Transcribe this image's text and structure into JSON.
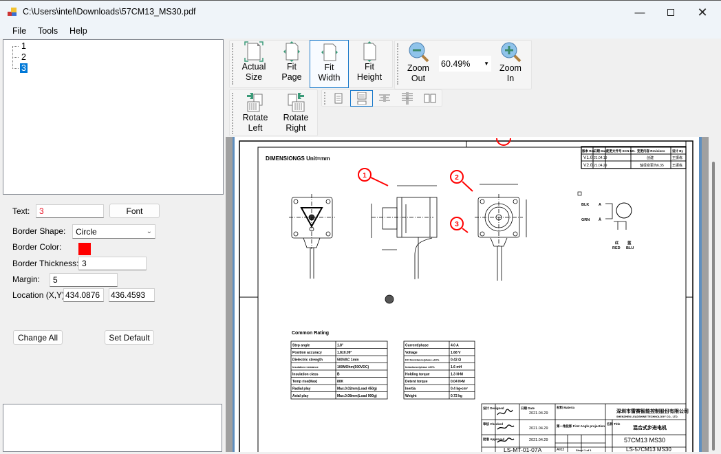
{
  "window": {
    "title": "C:\\Users\\intel\\Downloads\\57CM13_MS30.pdf",
    "minimize_icon": "minimize-icon",
    "maximize_icon": "maximize-icon",
    "close_icon": "close-icon"
  },
  "menu": [
    "File",
    "Tools",
    "Help"
  ],
  "tree": {
    "pages": [
      "1",
      "2",
      "3"
    ],
    "selected": "3"
  },
  "properties": {
    "text_label": "Text:",
    "text_value": "3",
    "text_color": "#ff0000",
    "font_button": "Font",
    "border_shape_label": "Border Shape:",
    "border_shape_value": "Circle",
    "border_color_label": "Border Color:",
    "border_color": "#ff0000",
    "border_thickness_label": "Border Thickness:",
    "border_thickness_value": "3",
    "margin_label": "Margin:",
    "margin_value": "5",
    "location_label": "Location (X,Y):",
    "location_x": "434.0876",
    "location_y": "436.4593",
    "change_all_button": "Change All",
    "set_default_button": "Set Default"
  },
  "toolbar": {
    "actual_size": [
      "Actual",
      "Size"
    ],
    "fit_page": [
      "Fit",
      "Page"
    ],
    "fit_width": [
      "Fit",
      "Width"
    ],
    "fit_height": [
      "Fit",
      "Height"
    ],
    "zoom_out": [
      "Zoom",
      "Out"
    ],
    "zoom_in": [
      "Zoom",
      "In"
    ],
    "zoom_value": "60.49%",
    "rotate_left": [
      "Rotate",
      "Left"
    ],
    "rotate_right": [
      "Rotate",
      "Right"
    ],
    "selected": "Fit Width",
    "selected_layout": "single-page-continuous"
  },
  "document": {
    "heading": "DIMENSIONGS Unit=mm",
    "annotations": [
      "1",
      "2",
      "3"
    ],
    "annotation_color": "#ff0000",
    "revision_table": {
      "headers": [
        "版本 Rev.",
        "日期 Date",
        "变更文件号 ECN NO.",
        "变更内容 Revisions",
        "设计 By"
      ],
      "rows": [
        [
          "V1.0",
          "21.04.19",
          "",
          "创建",
          "王振栋"
        ],
        [
          "V2.0",
          "21.04.29",
          "",
          "轴径变更为6.35",
          "王振栋"
        ]
      ]
    },
    "wiring": {
      "labels": [
        "BLK",
        "GRN",
        "RED",
        "BLU"
      ],
      "phases": [
        "A",
        "Ā"
      ],
      "colors_cn": [
        "红",
        "蓝"
      ]
    },
    "common_rating": {
      "title": "Common Rating",
      "left": [
        [
          "Step angle",
          "1.8°"
        ],
        [
          "Position accuracy",
          "1.8±0.09°"
        ],
        [
          "Dielectric strength",
          "500VAC 1min"
        ],
        [
          "Insulation resistance",
          "100MOhm(500VDC)"
        ],
        [
          "Insulation class",
          "B"
        ],
        [
          "Temp rise(Max)",
          "80K"
        ],
        [
          "Radial play",
          "Max.0.02mm(Load 450g)"
        ],
        [
          "Axial play",
          "Max.0.08mm(Load 900g)"
        ]
      ],
      "right": [
        [
          "Current/phase",
          "4.0 A"
        ],
        [
          "Voltage",
          "1.68 V"
        ],
        [
          "DC Resistance/phase ±10%",
          "0.42 Ω"
        ],
        [
          "Inductance/phase ±20%",
          "1.6 mH"
        ],
        [
          "Holding torque",
          "1.3 N•M"
        ],
        [
          "Detent torque",
          "0.04 N•M"
        ],
        [
          "Inertia",
          "0.4 kg•cm²"
        ],
        [
          "Weight",
          "0.72 kg"
        ]
      ]
    },
    "title_block": {
      "designed": "设计 Designed",
      "checked": "审核 Checked",
      "approved": "批准 Approved",
      "date_label": "日期 Date",
      "dates": [
        "2021.04.29",
        "2021.04.29",
        "2021.04.29"
      ],
      "material": "材料 Materia",
      "projection": "第一角投影 First Angle projection",
      "sheet_size": "A/02",
      "company_cn": "深圳市雷赛智能控制股份有限公司",
      "company_en": "SHENZHEN LEADSHINE TECHNOLOGY CO., LTD.",
      "title_label": "名称 Title",
      "title_cn": "混合式步进电机",
      "model": "57CM13 MS30",
      "drawing_no": "LS-MT-01-07A",
      "sheet": "Sheet 1 of 1",
      "part_no": "LS-57CM13 MS30"
    }
  }
}
